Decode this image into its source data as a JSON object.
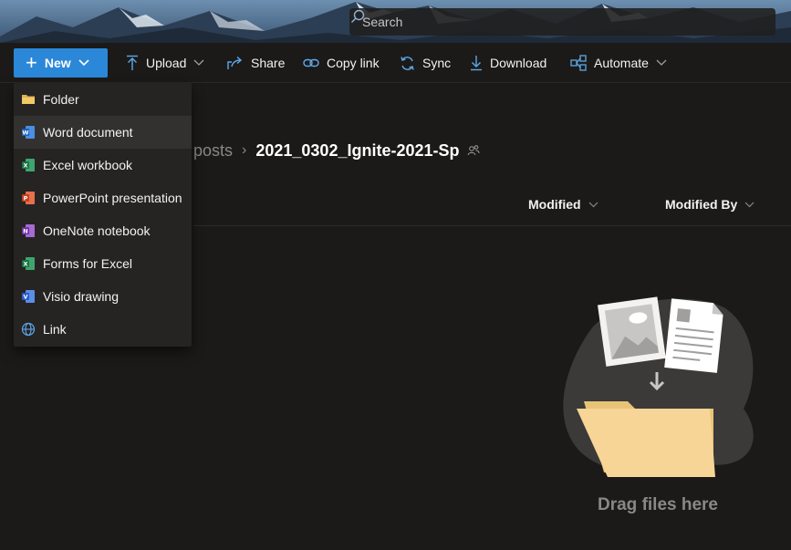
{
  "search": {
    "placeholder": "Search"
  },
  "toolbar": {
    "new_label": "New",
    "upload_label": "Upload",
    "share_label": "Share",
    "copy_link_label": "Copy link",
    "sync_label": "Sync",
    "download_label": "Download",
    "automate_label": "Automate"
  },
  "new_menu": {
    "items": [
      {
        "label": "Folder",
        "icon": "folder-icon"
      },
      {
        "label": "Word document",
        "icon": "word-icon"
      },
      {
        "label": "Excel workbook",
        "icon": "excel-icon"
      },
      {
        "label": "PowerPoint presentation",
        "icon": "powerpoint-icon"
      },
      {
        "label": "OneNote notebook",
        "icon": "onenote-icon"
      },
      {
        "label": "Forms for Excel",
        "icon": "forms-excel-icon"
      },
      {
        "label": "Visio drawing",
        "icon": "visio-icon"
      },
      {
        "label": "Link",
        "icon": "globe-icon"
      }
    ]
  },
  "breadcrumb": {
    "parent": "posts",
    "current": "2021_0302_Ignite-2021-Sp"
  },
  "columns": {
    "modified": "Modified",
    "modified_by": "Modified By"
  },
  "empty_state": {
    "message": "Drag files here"
  },
  "colors": {
    "accent": "#2b88d8",
    "background": "#1b1a19",
    "menu_bg": "#252423"
  }
}
